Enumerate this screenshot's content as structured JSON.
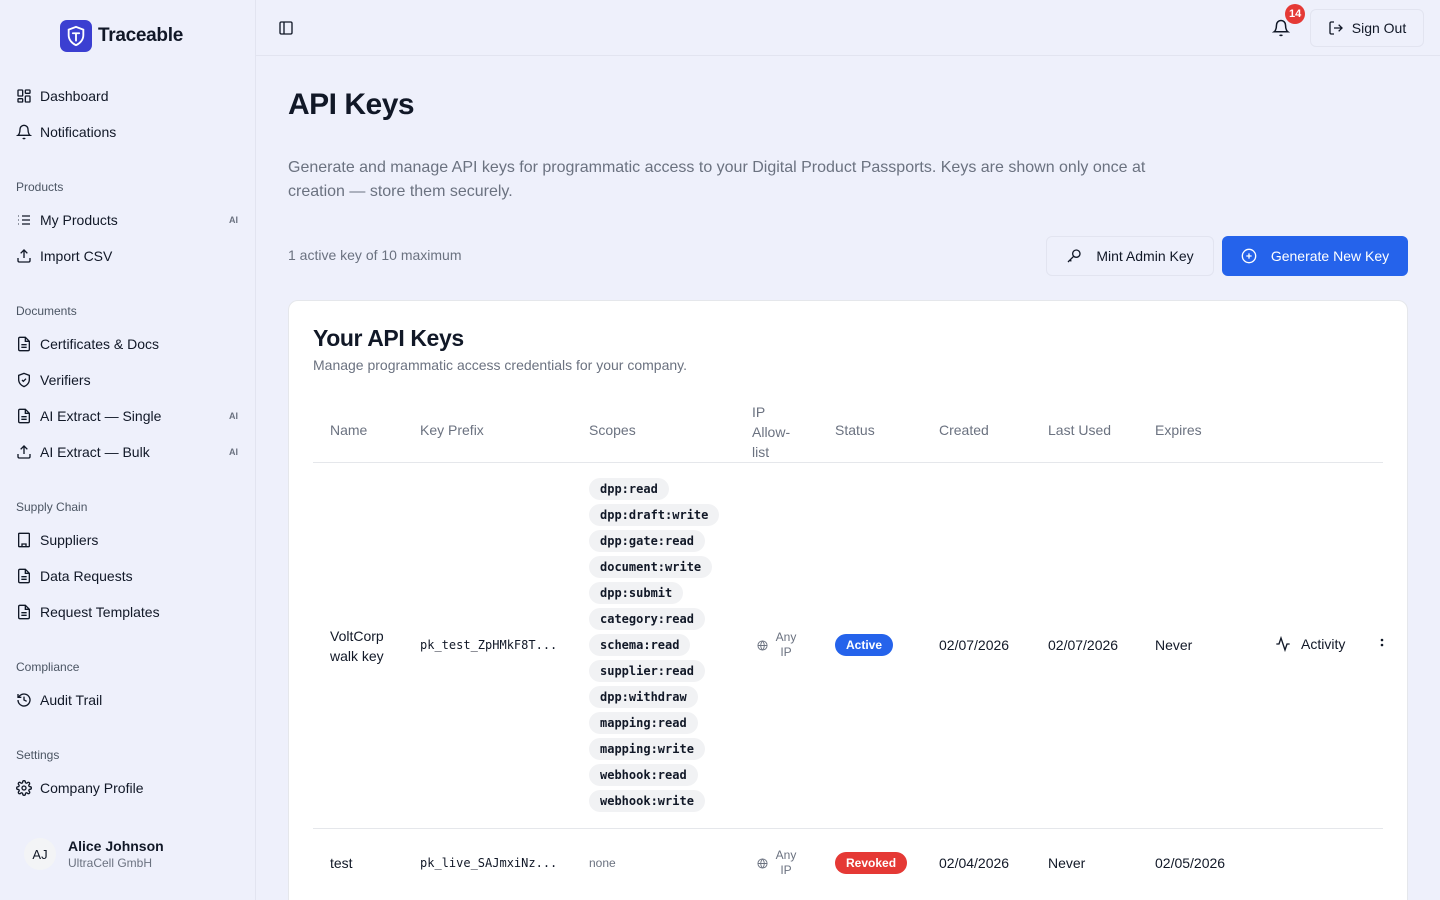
{
  "app": {
    "name": "Traceable"
  },
  "sidebar": {
    "top_items": [
      {
        "label": "Dashboard",
        "icon": "grid-icon"
      },
      {
        "label": "Notifications",
        "icon": "bell-icon"
      }
    ],
    "sections": [
      {
        "label": "Products",
        "items": [
          {
            "label": "My Products",
            "badge": "AI",
            "icon": "list-icon"
          },
          {
            "label": "Import CSV",
            "badge": "",
            "icon": "upload-icon"
          }
        ]
      },
      {
        "label": "Documents",
        "items": [
          {
            "label": "Certificates & Docs",
            "badge": "",
            "icon": "document-icon"
          },
          {
            "label": "Verifiers",
            "badge": "",
            "icon": "shield-icon"
          },
          {
            "label": "AI Extract — Single",
            "badge": "AI",
            "icon": "document-icon"
          },
          {
            "label": "AI Extract — Bulk",
            "badge": "AI",
            "icon": "upload-icon"
          }
        ]
      },
      {
        "label": "Supply Chain",
        "items": [
          {
            "label": "Suppliers",
            "badge": "",
            "icon": "building-icon"
          },
          {
            "label": "Data Requests",
            "badge": "",
            "icon": "document-icon"
          },
          {
            "label": "Request Templates",
            "badge": "",
            "icon": "document-icon"
          }
        ]
      },
      {
        "label": "Compliance",
        "items": [
          {
            "label": "Audit Trail",
            "badge": "",
            "icon": "history-icon"
          }
        ]
      },
      {
        "label": "Settings",
        "items": [
          {
            "label": "Company Profile",
            "badge": "",
            "icon": "gear-icon"
          }
        ]
      }
    ],
    "user": {
      "initials": "AJ",
      "name": "Alice Johnson",
      "company": "UltraCell GmbH"
    }
  },
  "topbar": {
    "notification_count": "14",
    "sign_out_label": "Sign Out"
  },
  "page": {
    "title": "API Keys",
    "description": "Generate and manage API keys for programmatic access to your Digital Product Passports. Keys are shown only once at creation — store them securely.",
    "key_count": "1 active key of 10 maximum",
    "mint_label": "Mint Admin Key",
    "generate_label": "Generate New Key"
  },
  "card": {
    "title": "Your API Keys",
    "subtitle": "Manage programmatic access credentials for your company.",
    "columns": [
      "Name",
      "Key Prefix",
      "Scopes",
      "IP Allow- list",
      "Status",
      "Created",
      "Last Used",
      "Expires"
    ],
    "rows": [
      {
        "name": "VoltCorp walk key",
        "prefix": "pk_test_ZpHMkF8T...",
        "scopes": [
          "dpp:read",
          "dpp:draft:write",
          "dpp:gate:read",
          "document:write",
          "dpp:submit",
          "category:read",
          "schema:read",
          "supplier:read",
          "dpp:withdraw",
          "mapping:read",
          "mapping:write",
          "webhook:read",
          "webhook:write"
        ],
        "ip": "Any IP",
        "status": "Active",
        "created": "02/07/2026",
        "last_used": "02/07/2026",
        "expires": "Never",
        "action": "Activity"
      },
      {
        "name": "test",
        "prefix": "pk_live_SAJmxiNz...",
        "scopes_text": "none",
        "ip": "Any IP",
        "status": "Revoked",
        "created": "02/04/2026",
        "last_used": "Never",
        "expires": "02/05/2026"
      }
    ]
  },
  "colors": {
    "primary": "#2563eb",
    "revoked": "#e53935",
    "brand": "#3b3fd1",
    "background": "#eef0fb"
  }
}
